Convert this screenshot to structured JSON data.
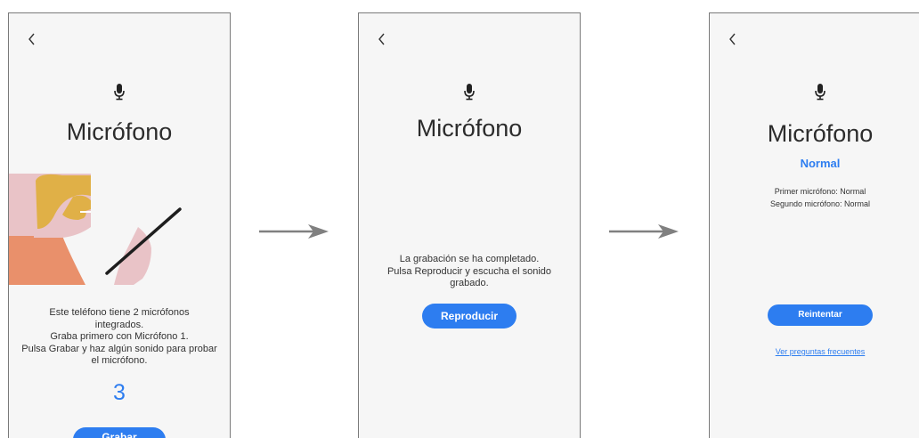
{
  "colors": {
    "accent": "#2d7df0",
    "screen_bg": "#f6f6f6",
    "text": "#2c2c2c"
  },
  "icons": {
    "back": "chevron-left-icon",
    "mic": "microphone-icon",
    "arrow": "arrow-right-icon"
  },
  "screen1": {
    "title": "Micrófono",
    "instructions": [
      "Este teléfono tiene 2 micrófonos",
      "integrados.",
      "Graba primero con Micrófono 1.",
      "Pulsa Grabar y haz algún sonido para probar",
      "el micrófono."
    ],
    "countdown": "3",
    "record_button": "Grabar"
  },
  "screen2": {
    "title": "Micrófono",
    "message": [
      "La grabación se ha completado.",
      "Pulsa Reproducir y escucha el sonido",
      "grabado."
    ],
    "play_button": "Reproducir"
  },
  "screen3": {
    "title": "Micrófono",
    "status": "Normal",
    "first_mic": "Primer micrófono: Normal",
    "second_mic": "Segundo micrófono: Normal",
    "retry_button": "Reintentar",
    "faq_link": "Ver preguntas frecuentes"
  }
}
